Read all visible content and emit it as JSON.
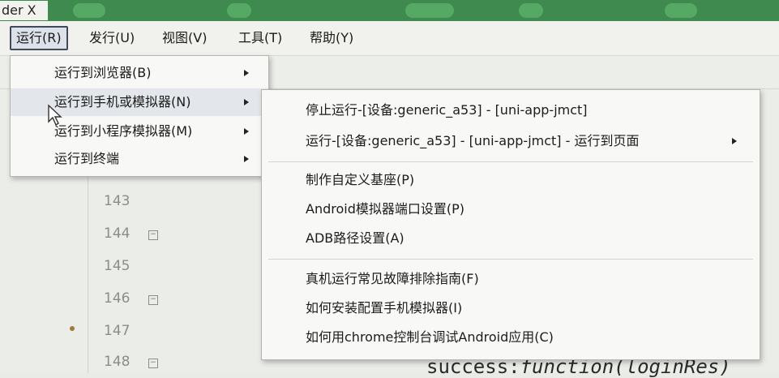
{
  "window": {
    "title": "der X"
  },
  "menubar": {
    "items": [
      {
        "label": "运行(R)",
        "active": true
      },
      {
        "label": "发行(U)"
      },
      {
        "label": "视图(V)"
      },
      {
        "label": "工具(T)"
      },
      {
        "label": "帮助(Y)"
      }
    ]
  },
  "run_menu": {
    "items": [
      {
        "label": "运行到浏览器(B)",
        "has_submenu": true
      },
      {
        "label": "运行到手机或模拟器(N)",
        "has_submenu": true,
        "hovered": true
      },
      {
        "label": "运行到小程序模拟器(M)",
        "has_submenu": true
      },
      {
        "label": "运行到终端",
        "has_submenu": true
      }
    ]
  },
  "device_submenu": {
    "items": [
      {
        "label": "停止运行-[设备:generic_a53] - [uni-app-jmct]"
      },
      {
        "label": "运行-[设备:generic_a53] - [uni-app-jmct] - 运行到页面",
        "has_submenu": true
      },
      {
        "label": "制作自定义基座(P)"
      },
      {
        "label": "Android模拟器端口设置(P)"
      },
      {
        "label": "ADB路径设置(A)"
      },
      {
        "label": "真机运行常见故障排除指南(F)"
      },
      {
        "label": "如何安装配置手机模拟器(I)"
      },
      {
        "label": "如何用chrome控制台调试Android应用(C)"
      }
    ]
  },
  "editor": {
    "line_numbers": [
      "143",
      "144",
      "145",
      "146",
      "147",
      "148"
    ],
    "fold_markers": [
      "144",
      "146",
      "148"
    ],
    "code_fragment": {
      "prefix": "success:",
      "keyword": "function(loginRes)"
    }
  },
  "icons": {
    "submenu": "chevron-right-icon",
    "fold": "fold-minus-icon",
    "cursor": "mouse-pointer-icon",
    "breakpoint": "breakpoint-dot-icon"
  }
}
